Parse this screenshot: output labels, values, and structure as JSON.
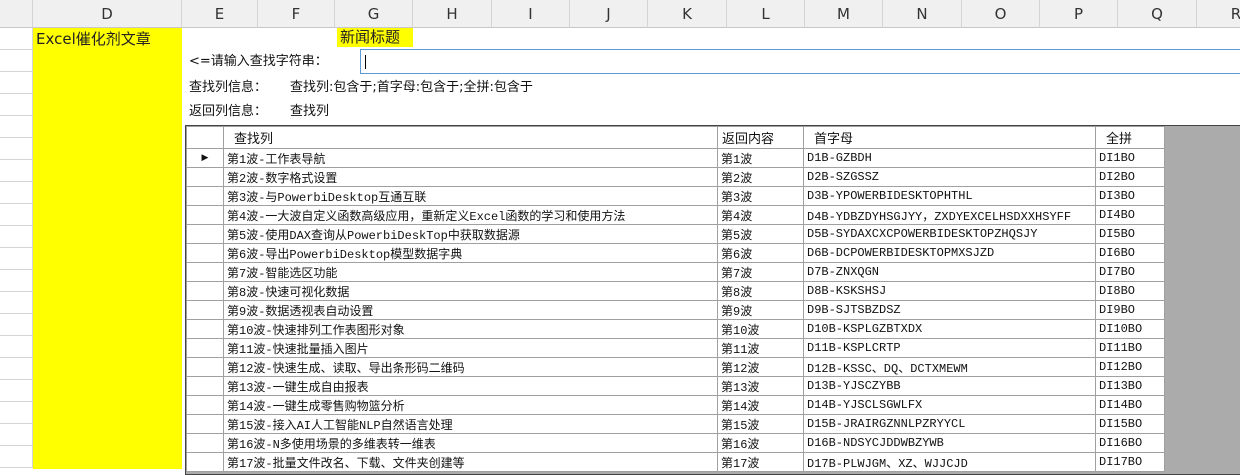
{
  "columns": [
    "D",
    "E",
    "F",
    "G",
    "H",
    "I",
    "J",
    "K",
    "L",
    "M",
    "N",
    "O",
    "P",
    "Q",
    "R"
  ],
  "cells": {
    "d1": "Excel催化剂文章",
    "g1": "新闻标题"
  },
  "search": {
    "label": "<=请输入查找字符串：",
    "value": ""
  },
  "info": {
    "find_label": "查找列信息：",
    "find_value": "查找列:包含于;首字母:包含于;全拼:包含于",
    "return_label": "返回列信息：",
    "return_value": "查找列"
  },
  "grid": {
    "headers": [
      "查找列",
      "返回内容",
      "首字母",
      "全拼"
    ],
    "current_row_marker": "▶",
    "rows": [
      [
        "第1波-工作表导航",
        "第1波",
        "D1B-GZBDH",
        "DI1BO"
      ],
      [
        "第2波-数字格式设置",
        "第2波",
        "D2B-SZGSSZ",
        "DI2BO"
      ],
      [
        "第3波-与PowerbiDesktop互通互联",
        "第3波",
        "D3B-YPOWERBIDESKTOPHTHL",
        "DI3BO"
      ],
      [
        "第4波-一大波自定义函数高级应用，重新定义Excel函数的学习和使用方法",
        "第4波",
        "D4B-YDBZDYHSGJYY，ZXDYEXCELHSDXXHSYFF",
        "DI4BO"
      ],
      [
        "第5波-使用DAX查询从PowerbiDeskTop中获取数据源",
        "第5波",
        "D5B-SYDAXCXCPOWERBIDESKTOPZHQSJY",
        "DI5BO"
      ],
      [
        "第6波-导出PowerbiDesktop模型数据字典",
        "第6波",
        "D6B-DCPOWERBIDESKTOPMXSJZD",
        "DI6BO"
      ],
      [
        "第7波-智能选区功能",
        "第7波",
        "D7B-ZNXQGN",
        "DI7BO"
      ],
      [
        "第8波-快速可视化数据",
        "第8波",
        "D8B-KSKSHSJ",
        "DI8BO"
      ],
      [
        "第9波-数据透视表自动设置",
        "第9波",
        "D9B-SJTSBZDSZ",
        "DI9BO"
      ],
      [
        "第10波-快速排列工作表图形对象",
        "第10波",
        "D10B-KSPLGZBTXDX",
        "DI10BO"
      ],
      [
        "第11波-快速批量插入图片",
        "第11波",
        "D11B-KSPLCRTP",
        "DI11BO"
      ],
      [
        "第12波-快速生成、读取、导出条形码二维码",
        "第12波",
        "D12B-KSSC、DQ、DCTXMEWM",
        "DI12BO"
      ],
      [
        "第13波-一键生成自由报表",
        "第13波",
        "D13B-YJSCZYBB",
        "DI13BO"
      ],
      [
        "第14波-一键生成零售购物篮分析",
        "第14波",
        "D14B-YJSCLSGWLFX",
        "DI14BO"
      ],
      [
        "第15波-接入AI人工智能NLP自然语言处理",
        "第15波",
        "D15B-JRAIRGZNNLPZRYYCL",
        "DI15BO"
      ],
      [
        "第16波-N多使用场景的多维表转一维表",
        "第16波",
        "D16B-NDSYCJDDWBZYWB",
        "DI16BO"
      ],
      [
        "第17波-批量文件改名、下载、文件夹创建等",
        "第17波",
        "D17B-PLWJGM、XZ、WJJCJD",
        "DI17BO"
      ]
    ]
  }
}
